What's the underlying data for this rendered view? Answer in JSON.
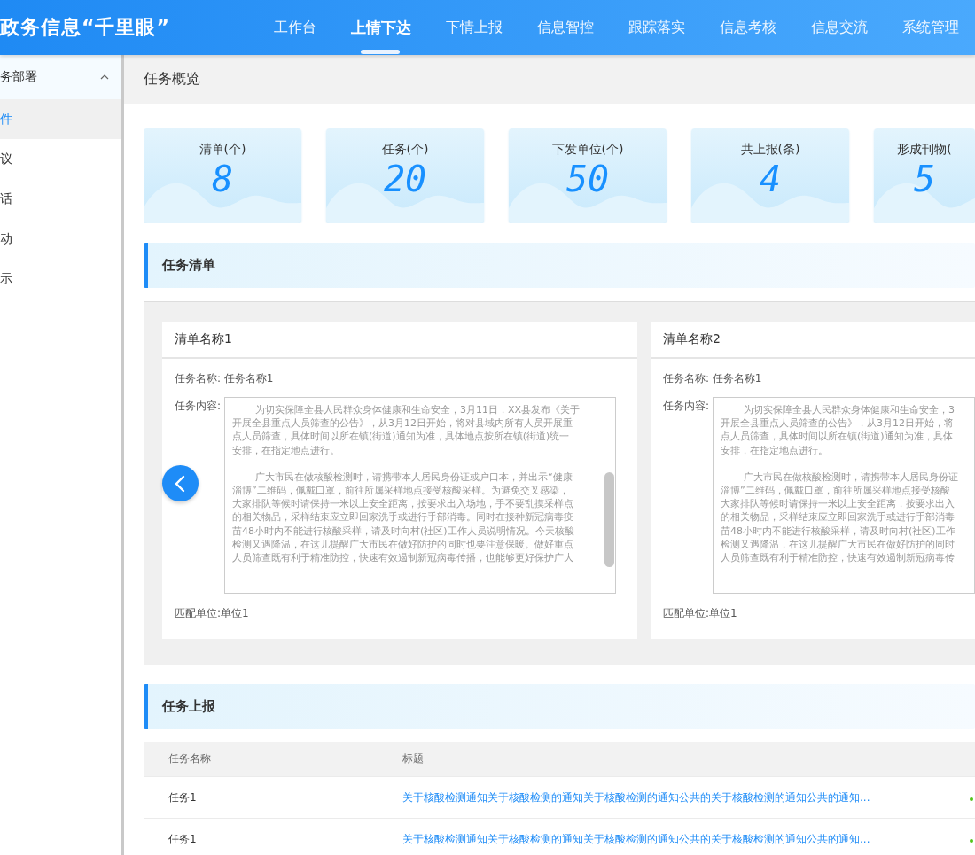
{
  "header": {
    "title": "政务信息“千里眼”",
    "nav": [
      {
        "label": "工作台",
        "selected": false
      },
      {
        "label": "上情下达",
        "selected": true
      },
      {
        "label": "下情上报",
        "selected": false
      },
      {
        "label": "信息智控",
        "selected": false
      },
      {
        "label": "跟踪落实",
        "selected": false
      },
      {
        "label": "信息考核",
        "selected": false
      },
      {
        "label": "信息交流",
        "selected": false
      },
      {
        "label": "系统管理",
        "selected": false
      }
    ]
  },
  "sidebar": {
    "group": {
      "label": "务部署",
      "expanded": true
    },
    "items": [
      {
        "label": "件",
        "selected": true
      },
      {
        "label": "议",
        "selected": false
      },
      {
        "label": "话",
        "selected": false
      },
      {
        "label": "动",
        "selected": false
      },
      {
        "label": "示",
        "selected": false
      }
    ]
  },
  "page_title": "任务概览",
  "stats": [
    {
      "label": "清单(个)",
      "value": "8"
    },
    {
      "label": "任务(个)",
      "value": "20"
    },
    {
      "label": "下发单位(个)",
      "value": "50"
    },
    {
      "label": "共上报(条)",
      "value": "4"
    },
    {
      "label": "形成刊物(",
      "value": "5"
    }
  ],
  "task_list": {
    "title": "任务清单",
    "cards": [
      {
        "title": "清单名称1",
        "task_name": "任务名称: 任务名称1",
        "content_label": "任务内容:",
        "paragraphs": [
          [
            "为切实保障全县人民群众身体健康和生命安全，3月11日，XX县发布《关于",
            "开展全县重点人员筛查的公告》，从3月12日开始，将对县域内所有人员开展重",
            "点人员筛查，具体时间以所在镇(街道)通知为准，具体地点按所在镇(街道)统一",
            "安排，在指定地点进行。"
          ],
          [
            "广大市民在做核酸检测时，请携带本人居民身份证或户口本，并出示“健康",
            "淄博”二维码，佩戴口罩，前往所属采样地点接受核酸采样。为避免交叉感染，",
            "大家排队等候时请保持一米以上安全距离，按要求出入场地，手不要乱摸采样点",
            "的相关物品，采样结束应立即回家洗手或进行手部消毒。同时在接种新冠病毒疫",
            "苗48小时内不能进行核酸采样，请及时向村(社区)工作人员说明情况。今天核酸",
            "检测又遇降温，在这儿提醒广大市民在做好防护的同时也要注意保暖。做好重点",
            "人员筛查既有利于精准防控，快速有效遏制新冠病毒传播，也能够更好保护广大"
          ]
        ],
        "unit": "匹配单位:单位1"
      },
      {
        "title": "清单名称2",
        "task_name": "任务名称: 任务名称1",
        "content_label": "任务内容:",
        "paragraphs": [
          [
            "为切实保障全县人民群众身体健康和生命安全，3",
            "开展全县重点人员筛查的公告》，从3月12日开始，将",
            "点人员筛查，具体时间以所在镇(街道)通知为准，具体",
            "安排，在指定地点进行。"
          ],
          [
            "广大市民在做核酸检测时，请携带本人居民身份证",
            "淄博”二维码，佩戴口罩，前往所属采样地点接受核酸",
            "大家排队等候时请保持一米以上安全距离，按要求出入",
            "的相关物品，采样结束应立即回家洗手或进行手部消毒",
            "苗48小时内不能进行核酸采样，请及时向村(社区)工作",
            "检测又遇降温，在这儿提醒广大市民在做好防护的同时",
            "人员筛查既有利于精准防控，快速有效遏制新冠病毒传"
          ]
        ],
        "unit": "匹配单位:单位1"
      }
    ]
  },
  "reports": {
    "title": "任务上报",
    "columns": [
      "任务名称",
      "标题"
    ],
    "rows": [
      {
        "name": "任务1",
        "title": "关于核酸检测通知关于核酸检测的通知关于核酸检测的通知公共的关于核酸检测的通知公共的通知..."
      },
      {
        "name": "任务1",
        "title": "关于核酸检测通知关于核酸检测的通知关于核酸检测的通知公共的关于核酸检测的通知公共的通知..."
      }
    ]
  }
}
